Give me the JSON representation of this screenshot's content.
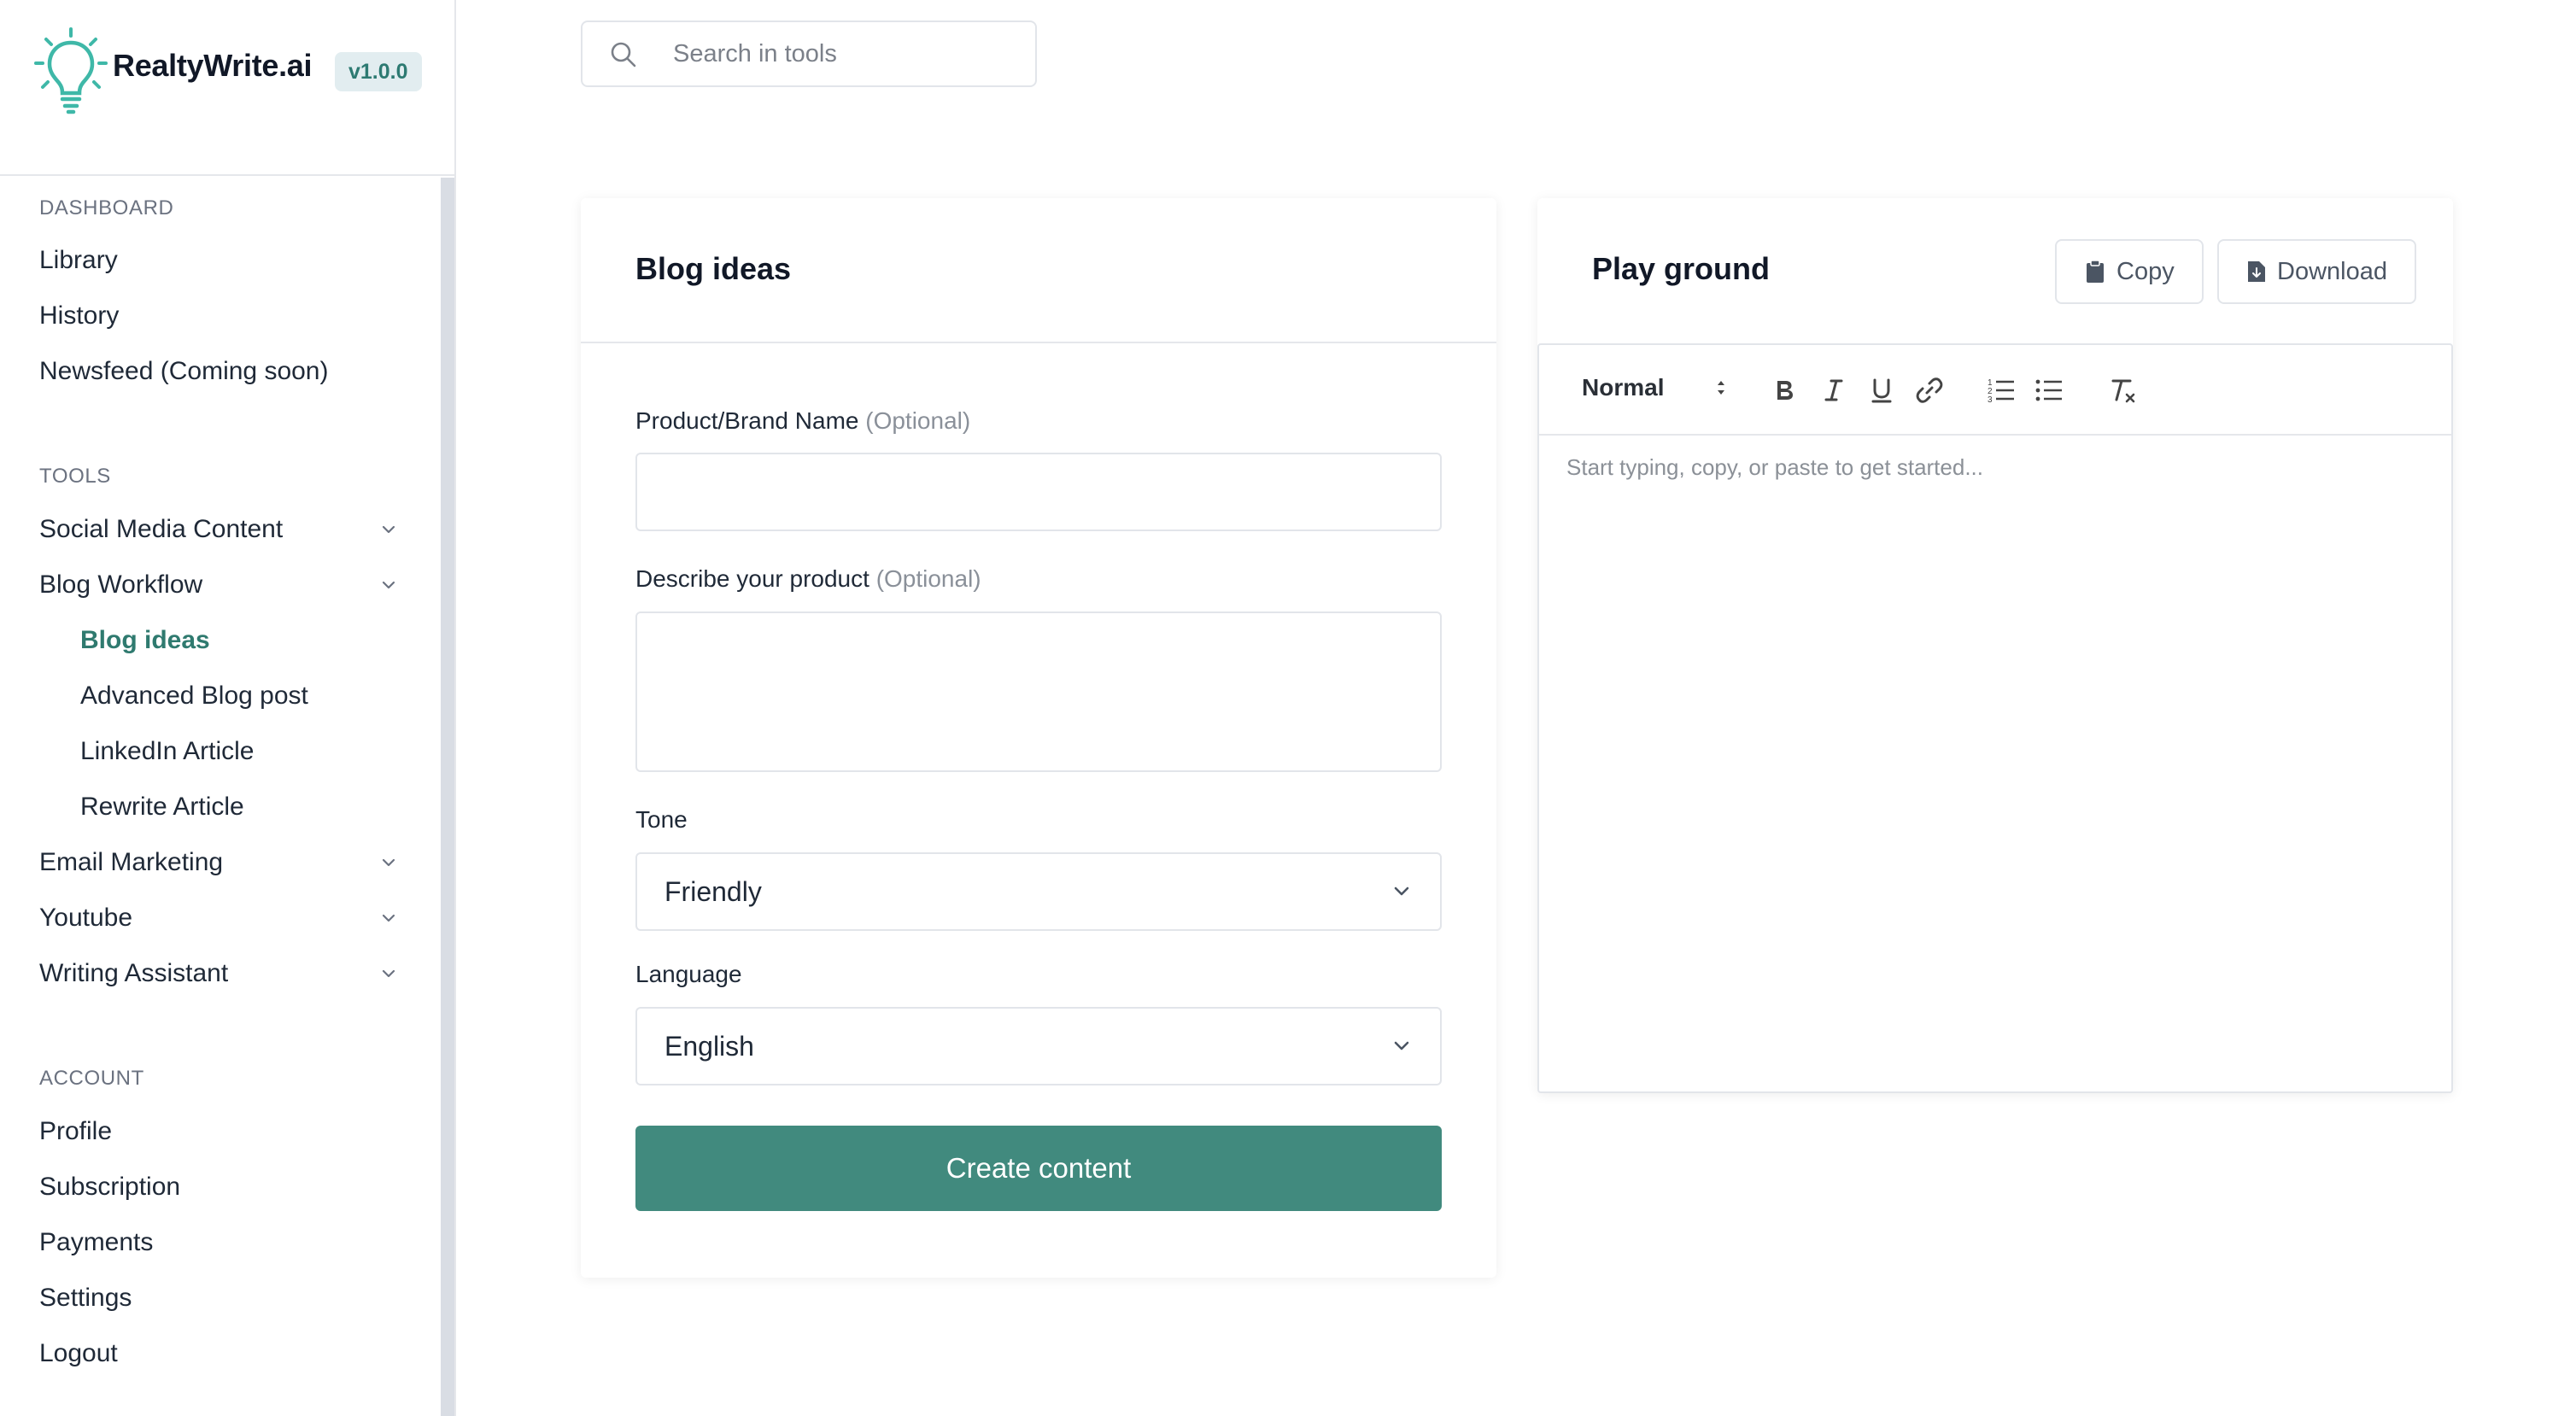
{
  "brand": {
    "name": "RealtyWrite.ai",
    "version": "v1.0.0",
    "accent_color": "#418a7e",
    "logo_icon": "lightbulb-icon"
  },
  "search": {
    "placeholder": "Search in tools",
    "icon": "search-icon"
  },
  "sidebar": {
    "sections": {
      "dashboard": "DASHBOARD",
      "tools": "TOOLS",
      "account": "ACCOUNT"
    },
    "dashboard_items": [
      "Library",
      "History",
      "Newsfeed (Coming soon)"
    ],
    "tools_items": {
      "social_media": "Social Media Content",
      "blog_workflow": "Blog Workflow",
      "blog_sub": [
        "Blog ideas",
        "Advanced Blog post",
        "LinkedIn Article",
        "Rewrite Article"
      ],
      "email_marketing": "Email Marketing",
      "youtube": "Youtube",
      "writing_assistant": "Writing Assistant"
    },
    "account_items": [
      "Profile",
      "Subscription",
      "Payments",
      "Settings",
      "Logout"
    ],
    "active_item": "Blog ideas"
  },
  "form": {
    "title": "Blog ideas",
    "product_label": "Product/Brand Name",
    "product_optional": "(Optional)",
    "product_value": "",
    "describe_label": "Describe your product",
    "describe_optional": "(Optional)",
    "describe_value": "",
    "tone_label": "Tone",
    "tone_value": "Friendly",
    "language_label": "Language",
    "language_value": "English",
    "submit_label": "Create content"
  },
  "playground": {
    "title": "Play ground",
    "copy_label": "Copy",
    "download_label": "Download",
    "format_value": "Normal",
    "editor_placeholder": "Start typing, copy, or paste to get started..."
  }
}
